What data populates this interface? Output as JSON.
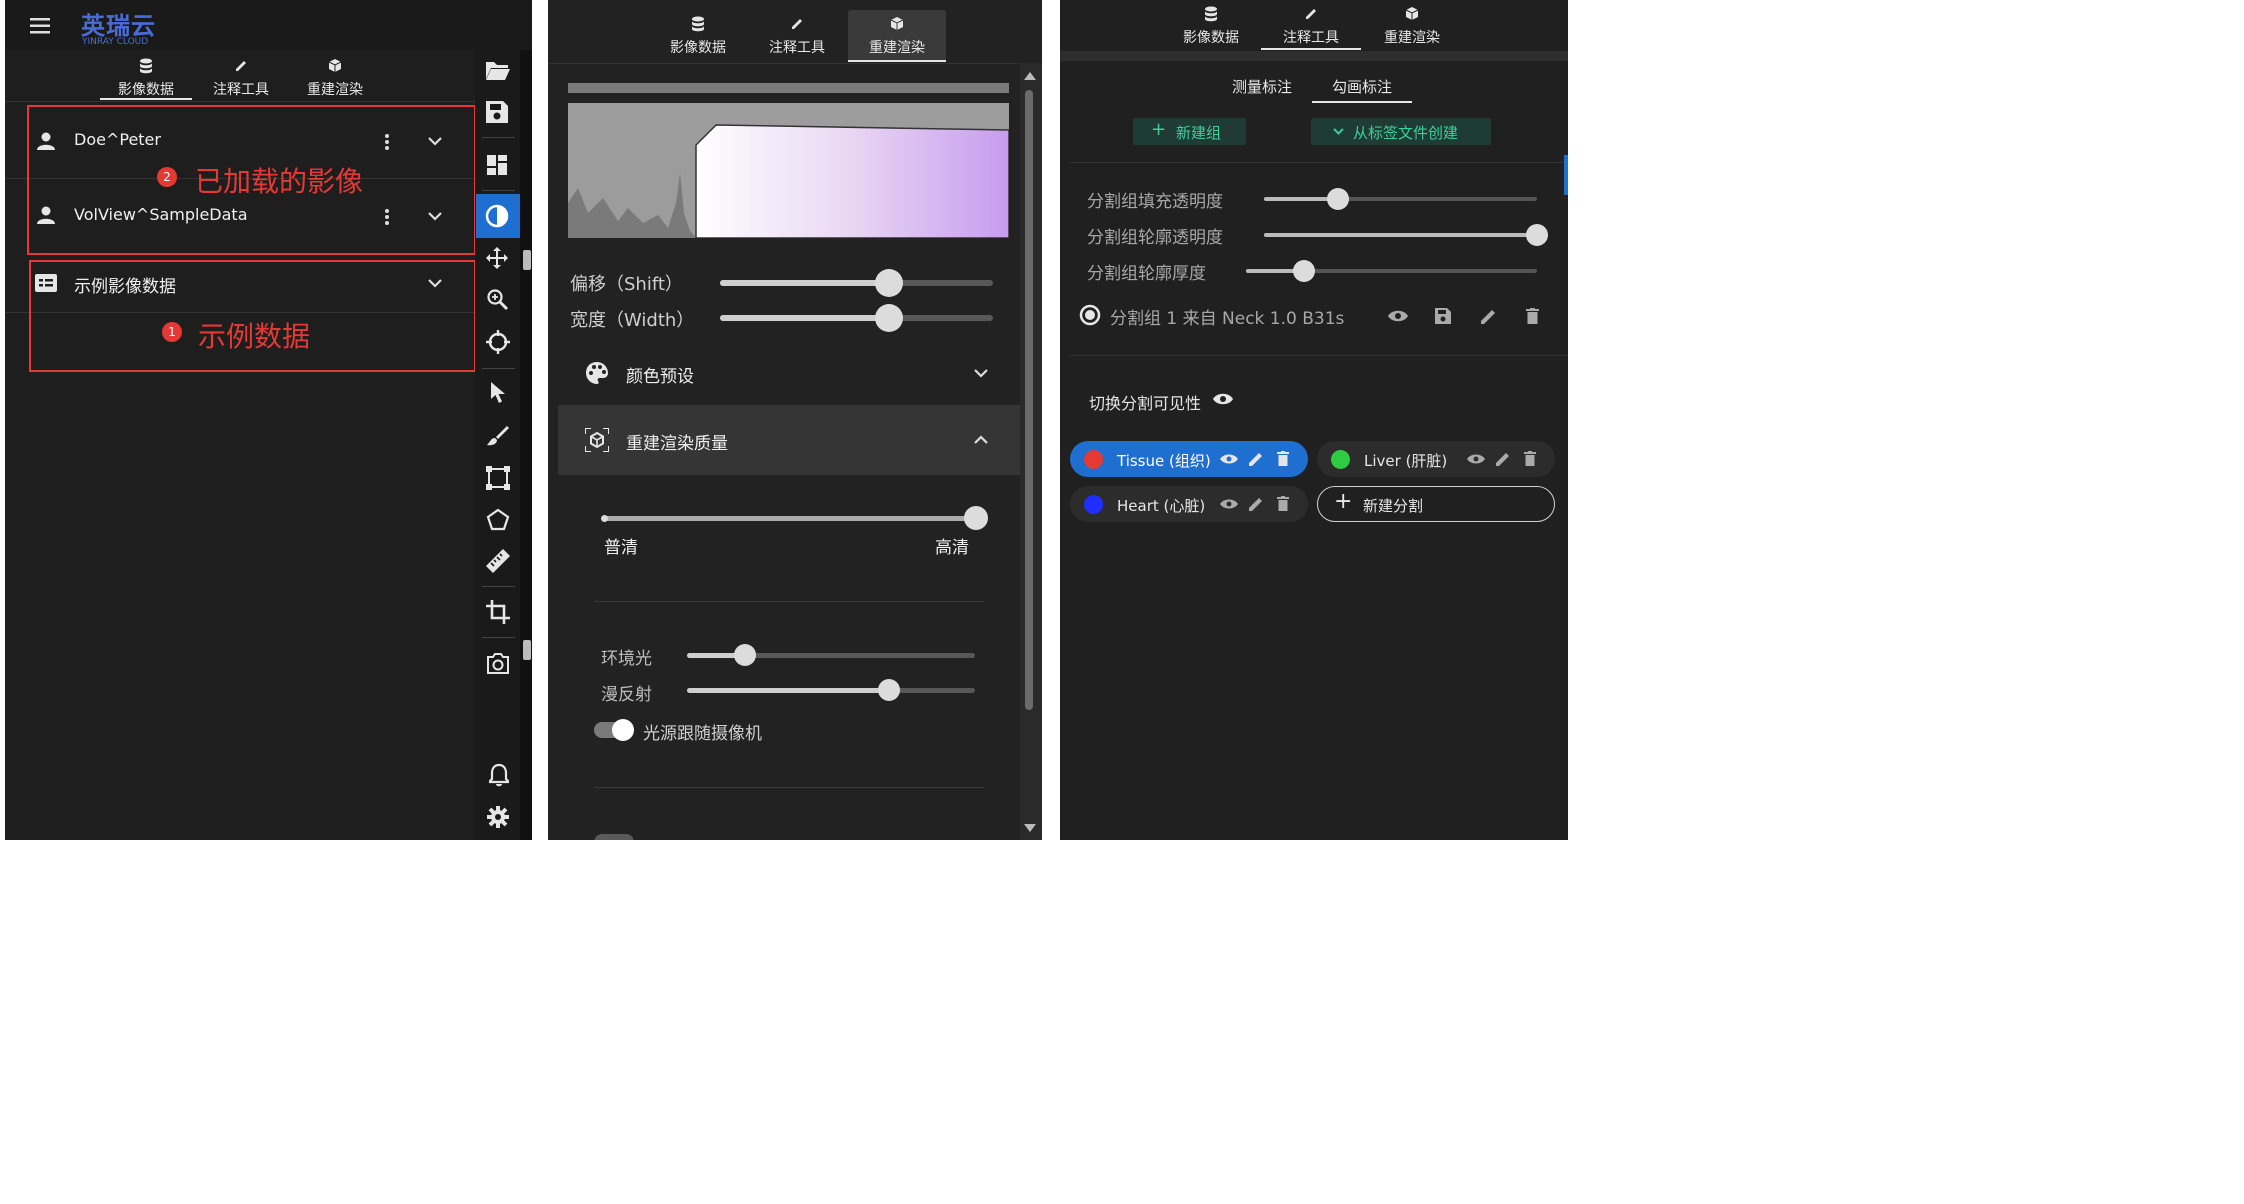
{
  "panel1": {
    "logo": {
      "cn": "英瑞云",
      "en": "YINRAY CLOUD"
    },
    "tabs": [
      {
        "label": "影像数据",
        "icon": "database-icon",
        "active": true
      },
      {
        "label": "注释工具",
        "icon": "pencil-icon",
        "active": false
      },
      {
        "label": "重建渲染",
        "icon": "cube-icon",
        "active": false
      }
    ],
    "patients": [
      {
        "name": "Doe^Peter"
      },
      {
        "name": "VolView^SampleData"
      }
    ],
    "sample_section": {
      "label": "示例影像数据"
    },
    "annotations": [
      {
        "number": "2",
        "text": "已加载的影像",
        "color": "#e53935"
      },
      {
        "number": "1",
        "text": "示例数据",
        "color": "#e53935"
      }
    ],
    "tool_icons": [
      "folder-open-icon",
      "save-icon",
      "layout-icon",
      "contrast-icon",
      "move-icon",
      "zoom-icon",
      "crosshair-icon",
      "cursor-icon",
      "brush-icon",
      "bounding-box-icon",
      "polygon-icon",
      "ruler-icon",
      "crop-icon",
      "camera-rotate-icon",
      "bell-icon",
      "settings-icon"
    ]
  },
  "panel2": {
    "tabs": [
      {
        "label": "影像数据",
        "active": false
      },
      {
        "label": "注释工具",
        "active": false
      },
      {
        "label": "重建渲染",
        "active": true
      }
    ],
    "sliders": {
      "shift": {
        "label": "偏移（Shift）",
        "value": 0.62
      },
      "width": {
        "label": "宽度（Width）",
        "value": 0.62
      }
    },
    "color_preset": {
      "label": "颜色预设"
    },
    "quality": {
      "label": "重建渲染质量",
      "value": 1.0,
      "low_label": "普清",
      "high_label": "高清"
    },
    "ambient": {
      "label": "环境光",
      "value": 0.2
    },
    "diffuse": {
      "label": "漫反射",
      "value": 0.7
    },
    "light_follow": {
      "label": "光源跟随摄像机",
      "on": true
    }
  },
  "panel3": {
    "tabs": [
      {
        "label": "影像数据",
        "active": false
      },
      {
        "label": "注释工具",
        "active": true
      },
      {
        "label": "重建渲染",
        "active": false
      }
    ],
    "subtabs": [
      {
        "label": "测量标注",
        "active": false
      },
      {
        "label": "勾画标注",
        "active": true
      }
    ],
    "buttons": {
      "new_group": "新建组",
      "from_label_file": "从标签文件创建"
    },
    "sliders": [
      {
        "label": "分割组填充透明度",
        "value": 0.27
      },
      {
        "label": "分割组轮廓透明度",
        "value": 1.0
      },
      {
        "label": "分割组轮廓厚度",
        "value": 0.2
      }
    ],
    "group": {
      "label": "分割组 1 来自 Neck 1.0 B31s"
    },
    "toggle_visibility": "切换分割可见性",
    "segments": [
      {
        "label": "Tissue (组织)",
        "color": "#e53935",
        "selected": true
      },
      {
        "label": "Liver (肝脏)",
        "color": "#2ecc40",
        "selected": false
      },
      {
        "label": "Heart (心脏)",
        "color": "#1e2fff",
        "selected": false
      }
    ],
    "new_segment": "新建分割"
  }
}
